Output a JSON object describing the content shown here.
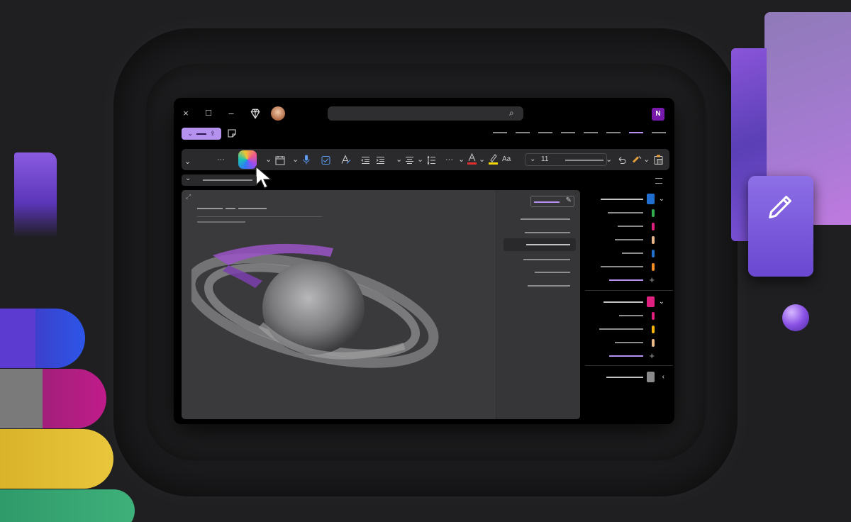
{
  "window": {
    "close_icon": "×",
    "maximize_icon": "☐",
    "minimize_icon": "–",
    "premium_icon": "diamond-icon",
    "app_logo_text": "N"
  },
  "ribbon": {
    "font_size": "11",
    "more_label": "···",
    "text_style_label": "Aa"
  },
  "colors": {
    "accent": "#b592ee",
    "window_bg": "#000000",
    "canvas_bg": "#3a3a3c",
    "notebook_blue": "#1f6fd1",
    "notebook_pink": "#e0207f"
  }
}
